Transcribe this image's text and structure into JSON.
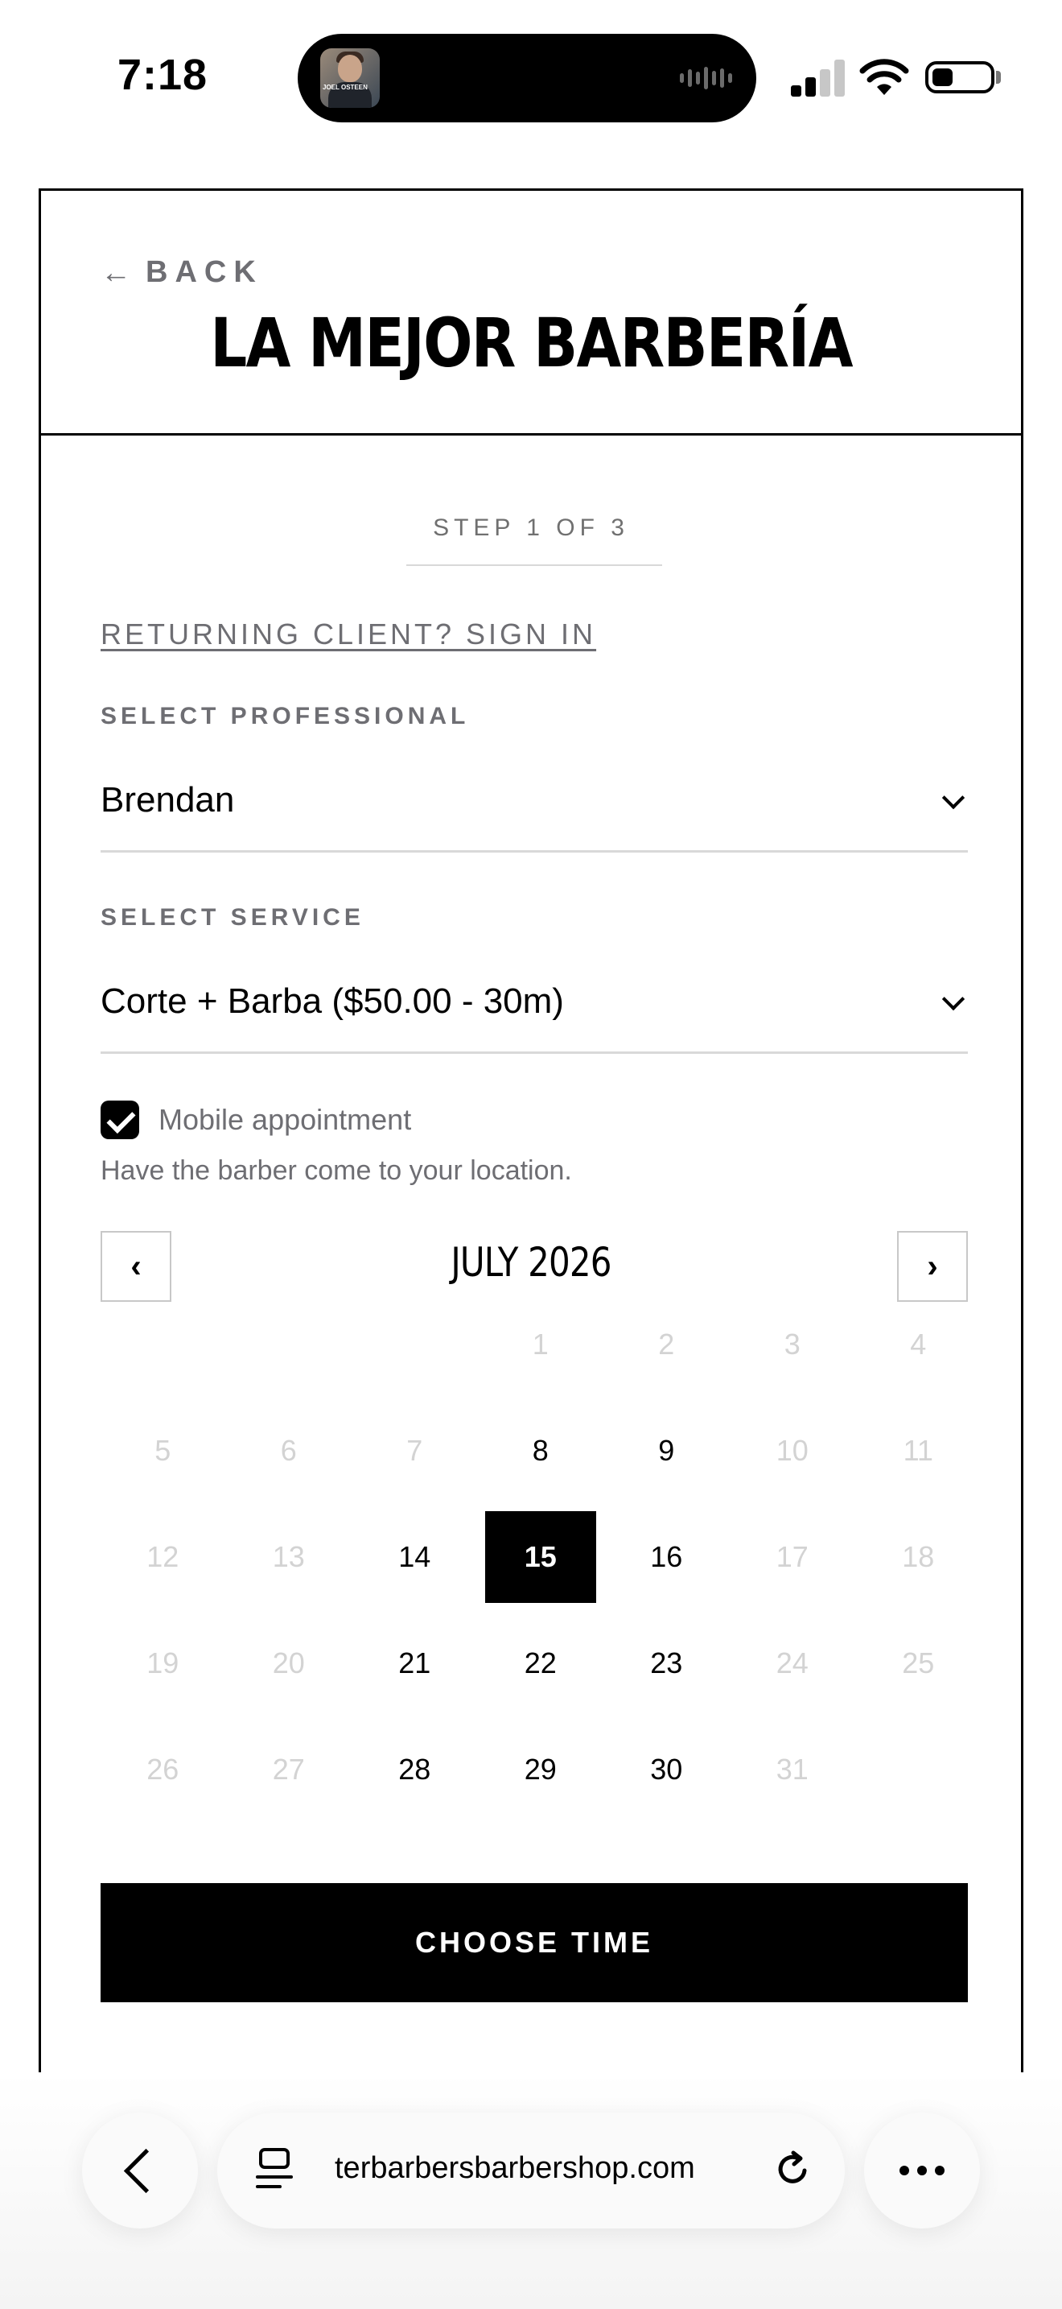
{
  "status_bar": {
    "time": "7:18",
    "island_thumbnail_icon": "podcast-artwork-icon",
    "island_thumbnail_text": "JOEL OSTEEN",
    "wave_icon": "audio-wave-icon",
    "signal_icon": "cellular-signal-icon",
    "signal_bars_active": 2,
    "signal_bars_total": 4,
    "wifi_icon": "wifi-icon",
    "battery_icon": "battery-icon",
    "battery_level": 0.35
  },
  "header": {
    "back_label": "BACK",
    "back_icon": "arrow-left-icon",
    "title": "LA MEJOR BARBERÍA"
  },
  "form": {
    "step_text": "STEP 1 OF 3",
    "signin_link": "RETURNING CLIENT? SIGN IN",
    "professional": {
      "label": "SELECT PROFESSIONAL",
      "value": "Brendan",
      "icon": "chevron-down-icon"
    },
    "service": {
      "label": "SELECT SERVICE",
      "value": "Corte + Barba ($50.00 - 30m)",
      "icon": "chevron-down-icon"
    },
    "mobile_appointment": {
      "checked": true,
      "label": "Mobile appointment",
      "help": "Have the barber come to your location."
    }
  },
  "calendar": {
    "month_label": "JULY 2026",
    "prev_label": "‹",
    "next_label": "›",
    "first_weekday_index": 3,
    "days": [
      {
        "n": "1",
        "available": false
      },
      {
        "n": "2",
        "available": false
      },
      {
        "n": "3",
        "available": false
      },
      {
        "n": "4",
        "available": false
      },
      {
        "n": "5",
        "available": false
      },
      {
        "n": "6",
        "available": false
      },
      {
        "n": "7",
        "available": false
      },
      {
        "n": "8",
        "available": true
      },
      {
        "n": "9",
        "available": true
      },
      {
        "n": "10",
        "available": false
      },
      {
        "n": "11",
        "available": false
      },
      {
        "n": "12",
        "available": false
      },
      {
        "n": "13",
        "available": false
      },
      {
        "n": "14",
        "available": true
      },
      {
        "n": "15",
        "available": true,
        "selected": true
      },
      {
        "n": "16",
        "available": true
      },
      {
        "n": "17",
        "available": false
      },
      {
        "n": "18",
        "available": false
      },
      {
        "n": "19",
        "available": false
      },
      {
        "n": "20",
        "available": false
      },
      {
        "n": "21",
        "available": true
      },
      {
        "n": "22",
        "available": true
      },
      {
        "n": "23",
        "available": true
      },
      {
        "n": "24",
        "available": false
      },
      {
        "n": "25",
        "available": false
      },
      {
        "n": "26",
        "available": false
      },
      {
        "n": "27",
        "available": false
      },
      {
        "n": "28",
        "available": true
      },
      {
        "n": "29",
        "available": true
      },
      {
        "n": "30",
        "available": true
      },
      {
        "n": "31",
        "available": false
      }
    ]
  },
  "cta": {
    "label": "CHOOSE TIME"
  },
  "browser": {
    "back_icon": "chevron-left-icon",
    "tabs_icon": "tabs-icon",
    "url": "terbarbersbarbershop.com",
    "reload_icon": "reload-icon",
    "more_icon": "more-dots-icon"
  },
  "colors": {
    "accent": "#000000",
    "muted_text": "#6e6e73",
    "disabled_day": "#d3d3d3",
    "divider": "#d9d9d9"
  }
}
